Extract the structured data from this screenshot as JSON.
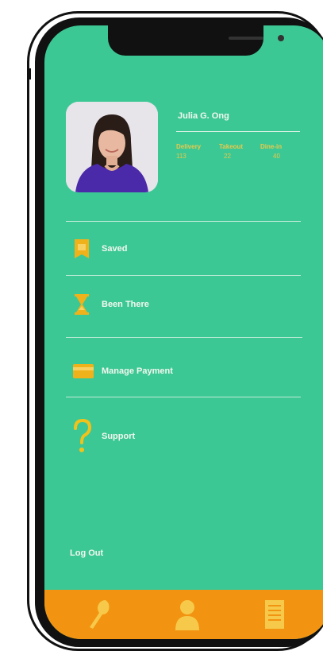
{
  "profile": {
    "name": "Julia G. Ong",
    "stats": [
      {
        "label": "Delivery",
        "value": "113"
      },
      {
        "label": "Takeout",
        "value": "22"
      },
      {
        "label": "Dine-in",
        "value": "40"
      }
    ]
  },
  "menu": {
    "saved_label": "Saved",
    "been_there_label": "Been There",
    "manage_payment_label": "Manage Payment",
    "support_label": "Support"
  },
  "logout_label": "Log Out",
  "tabs": {
    "icons": [
      "utensils-icon",
      "profile-icon",
      "receipt-icon"
    ]
  },
  "colors": {
    "screen": "#3cc894",
    "tabbar": "#f29411",
    "accent": "#f2c21a",
    "icon_orange": "#f0b21a"
  }
}
